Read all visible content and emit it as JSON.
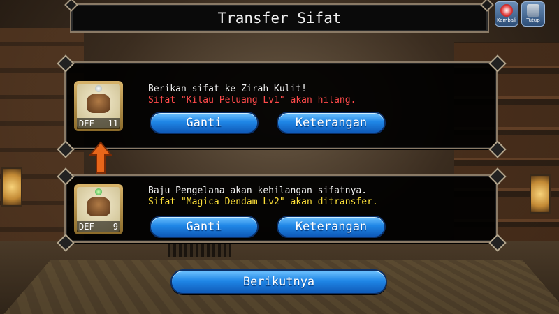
{
  "header": {
    "title": "Transfer Sifat",
    "back_label": "Kembali",
    "close_label": "Tutup"
  },
  "target": {
    "stat_label": "DEF",
    "stat_value": "11",
    "line1": "Berikan sifat ke Zirah Kulit!",
    "line2": "Sifat \"Kilau Peluang Lv1\" akan hilang.",
    "change_label": "Ganti",
    "info_label": "Keterangan"
  },
  "source": {
    "stat_label": "DEF",
    "stat_value": "9",
    "line1": "Baju Pengelana akan kehilangan sifatnya.",
    "line2": "Sifat \"Magica Dendam Lv2\" akan ditransfer.",
    "change_label": "Ganti",
    "info_label": "Keterangan"
  },
  "footer": {
    "next_label": "Berikutnya"
  },
  "colors": {
    "warning_text": "#ff4a4a",
    "transfer_text": "#ffe23a",
    "button_blue": "#1f86e6",
    "arrow_orange": "#e8661a"
  },
  "icons": {
    "target_gem": "white-gem-icon",
    "source_gem": "green-gem-icon",
    "arrow": "up-arrow-icon"
  }
}
